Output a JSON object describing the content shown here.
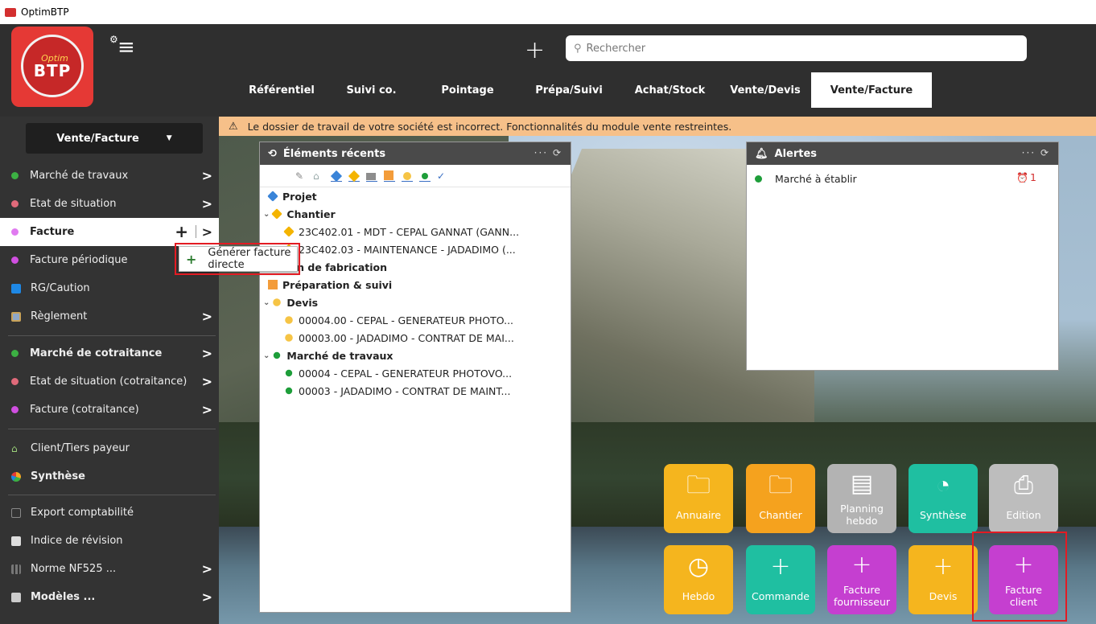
{
  "app": {
    "title": "OptimBTP"
  },
  "logo": {
    "optim": "Optim",
    "btp": "BTP"
  },
  "search": {
    "placeholder": "Rechercher"
  },
  "nav": {
    "tabs": [
      {
        "label": "Référentiel"
      },
      {
        "label": "Suivi co."
      },
      {
        "label": "Pointage"
      },
      {
        "label": "Prépa/Suivi"
      },
      {
        "label": "Achat/Stock"
      },
      {
        "label": "Vente/Devis"
      },
      {
        "label": "Vente/Facture"
      }
    ],
    "active": "Vente/Facture"
  },
  "sidebar": {
    "module": "Vente/Facture",
    "items": [
      {
        "label": "Marché de travaux",
        "color": "#3cb043"
      },
      {
        "label": "Etat de situation",
        "color": "#e06a7a"
      },
      {
        "label": "Facture",
        "color": "#d04fe0"
      },
      {
        "label": "Facture périodique",
        "color": "#d04fe0"
      },
      {
        "label": "RG/Caution",
        "color": "#1e88e5"
      },
      {
        "label": "Règlement"
      },
      {
        "label": "Marché de cotraitance",
        "color": "#3cb043"
      },
      {
        "label": "Etat de situation (cotraitance)",
        "color": "#e06a7a"
      },
      {
        "label": "Facture (cotraitance)",
        "color": "#d04fe0"
      },
      {
        "label": "Client/Tiers payeur"
      },
      {
        "label": "Synthèse"
      },
      {
        "label": "Export comptabilité"
      },
      {
        "label": "Indice de révision"
      },
      {
        "label": "Norme NF525 ..."
      },
      {
        "label": "Modèles ..."
      }
    ]
  },
  "context_menu": {
    "item": "Générer facture directe"
  },
  "warning": {
    "text": "Le dossier de travail de votre société est incorrect. Fonctionnalités du module vente restreintes."
  },
  "recent": {
    "title": "Éléments récents",
    "actions": "···",
    "rows": [
      {
        "label": "Projet"
      },
      {
        "label": "Chantier"
      },
      {
        "label": "23C402.01 - MDT - CEPAL GANNAT (GANN..."
      },
      {
        "label": "23C402.03 - MAINTENANCE - JADADIMO (..."
      },
      {
        "label": "Bon de fabrication"
      },
      {
        "label": "Préparation & suivi"
      },
      {
        "label": "Devis"
      },
      {
        "label": "00004.00 - CEPAL  - GENERATEUR PHOTO..."
      },
      {
        "label": "00003.00 - JADADIMO - CONTRAT DE MAI..."
      },
      {
        "label": "Marché de travaux"
      },
      {
        "label": "00004 - CEPAL  - GENERATEUR PHOTOVO..."
      },
      {
        "label": "00003 - JADADIMO - CONTRAT DE MAINT..."
      }
    ]
  },
  "alerts": {
    "title": "Alertes",
    "actions": "···",
    "items": [
      {
        "label": "Marché à établir",
        "count": "1"
      }
    ]
  },
  "tiles": [
    {
      "label": "Annuaire",
      "color": "#f5b51e",
      "icon": "folder-icon"
    },
    {
      "label": "Chantier",
      "color": "#f5a21e",
      "icon": "folder-icon"
    },
    {
      "label": "Planning\nhebdo",
      "color": "#b3b3b3",
      "icon": "calendar-icon"
    },
    {
      "label": "Synthèse",
      "color": "#1fbfa1",
      "icon": "pie-chart-icon"
    },
    {
      "label": "Edition",
      "color": "#bdbdbd",
      "icon": "printer-icon"
    },
    {
      "label": "Hebdo",
      "color": "#f5b51e",
      "icon": "clock-icon"
    },
    {
      "label": "Commande",
      "color": "#1fbfa1",
      "icon": "plus-icon"
    },
    {
      "label": "Facture\nfournisseur",
      "color": "#c53fd0",
      "icon": "plus-icon"
    },
    {
      "label": "Devis",
      "color": "#f5b51e",
      "icon": "plus-icon"
    },
    {
      "label": "Facture\nclient",
      "color": "#c53fd0",
      "icon": "plus-icon"
    }
  ],
  "colors": {
    "highlight": "#e31b23",
    "warning_bg": "#f6c089"
  }
}
